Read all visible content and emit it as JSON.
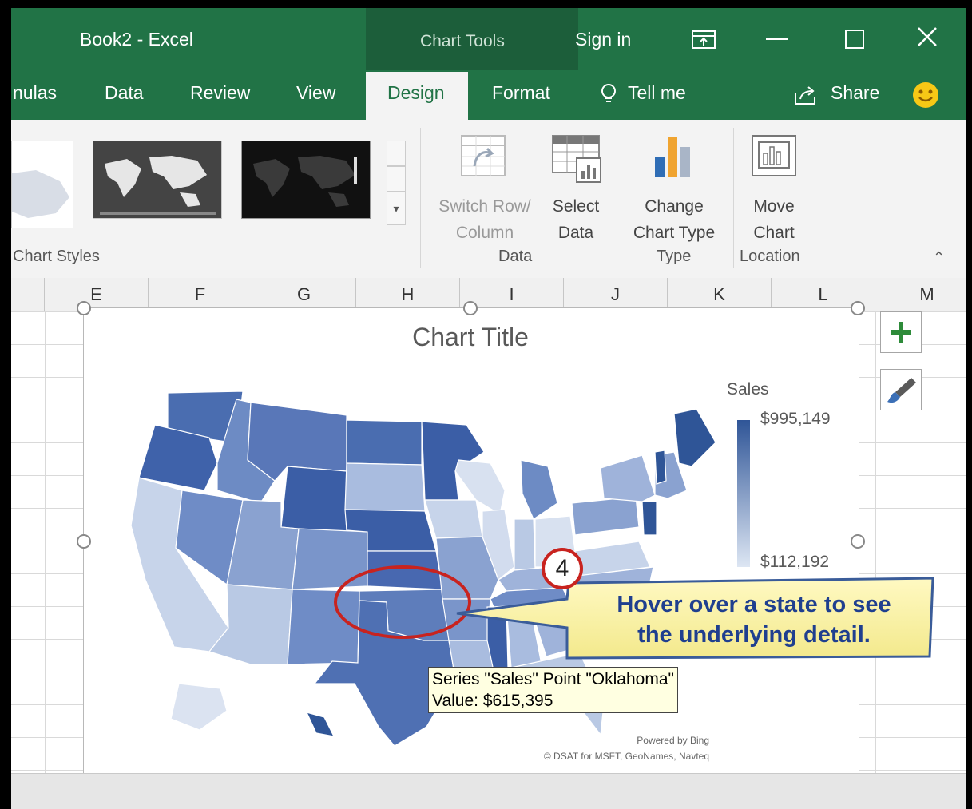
{
  "window": {
    "title": "Book2  -  Excel",
    "context_tab_group": "Chart Tools",
    "sign_in": "Sign in"
  },
  "tabs": [
    "nulas",
    "Data",
    "Review",
    "View",
    "Design",
    "Format"
  ],
  "active_tab": "Design",
  "tell_me": "Tell me",
  "share": "Share",
  "ribbon": {
    "switch_row_column": [
      "Switch Row/",
      "Column"
    ],
    "select_data": [
      "Select",
      "Data"
    ],
    "change_chart_type": [
      "Change",
      "Chart Type"
    ],
    "move_chart": [
      "Move",
      "Chart"
    ],
    "groups": {
      "chart_styles": "Chart Styles",
      "data": "Data",
      "type": "Type",
      "location": "Location"
    }
  },
  "columns": [
    "E",
    "F",
    "G",
    "H",
    "I",
    "J",
    "K",
    "L",
    "M"
  ],
  "chart": {
    "title": "Chart Title",
    "legend_title": "Sales",
    "legend_max": "$995,149",
    "legend_min": "$112,192",
    "credit_line1": "Powered by Bing",
    "credit_line2": "© DSAT for MSFT, GeoNames, Navteq",
    "colors": {
      "high": "#2f5597",
      "low": "#dde6f3"
    }
  },
  "callout": {
    "step_number": "4",
    "line1": "Hover over a state to see",
    "line2": "the underlying detail."
  },
  "tooltip": {
    "line1": "Series \"Sales\" Point \"Oklahoma\"",
    "line2": "Value: $615,395"
  },
  "icons": {
    "add_chart_element": "plus-icon",
    "chart_styles_brush": "brush-icon",
    "smiley": "smiley-icon"
  }
}
